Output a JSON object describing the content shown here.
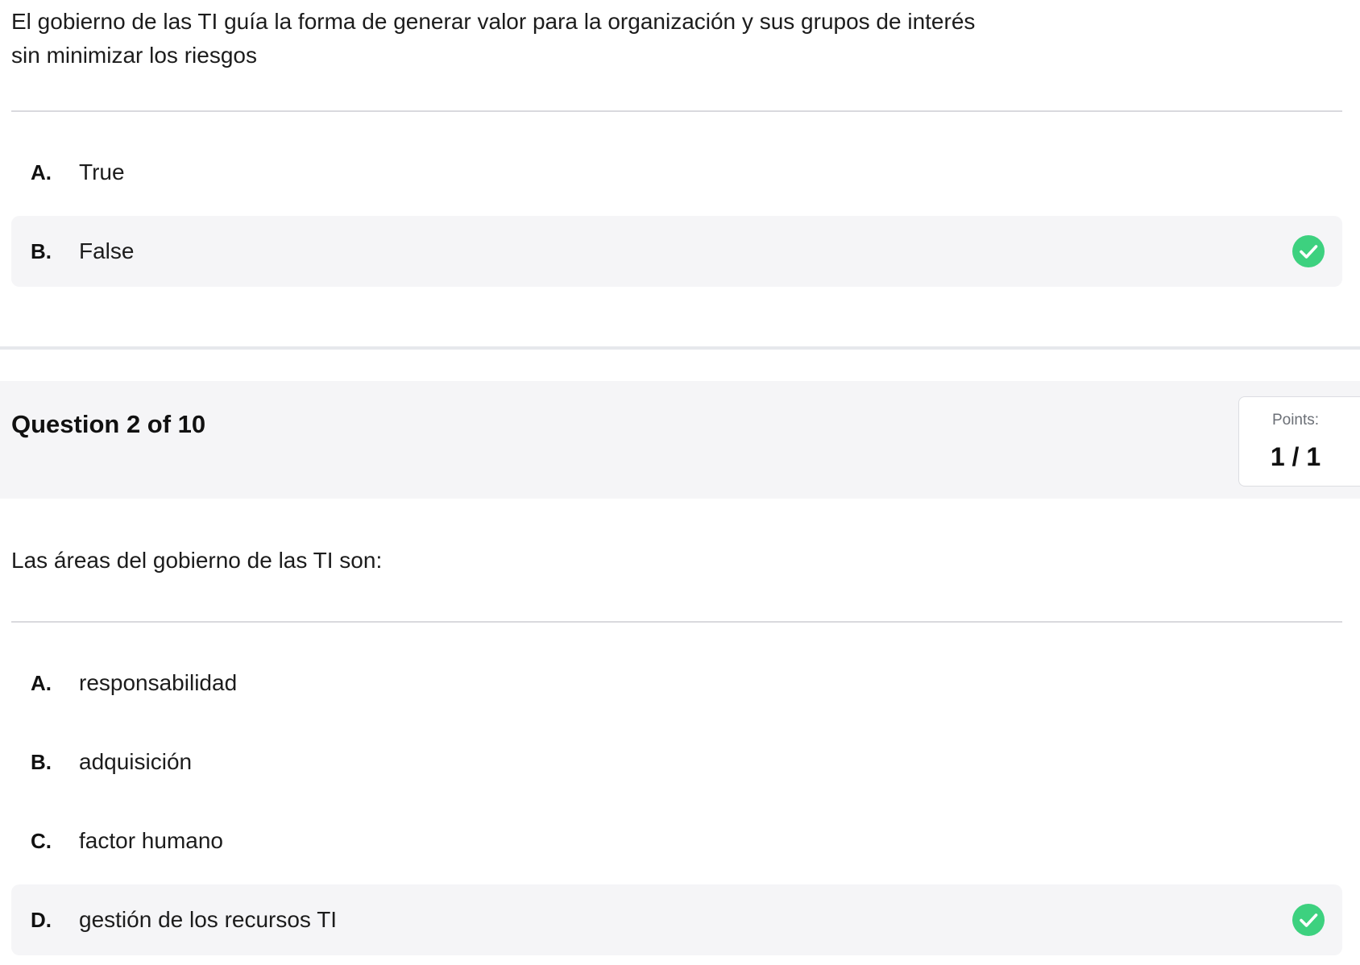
{
  "question1": {
    "text": "El gobierno de las TI guía la forma de generar valor para la organización y sus grupos de interés sin minimizar los riesgos",
    "options": [
      {
        "letter": "A.",
        "text": "True",
        "selected": false
      },
      {
        "letter": "B.",
        "text": "False",
        "selected": true,
        "icon": "check-circle-icon"
      }
    ]
  },
  "question2": {
    "title": "Question 2 of 10",
    "points_label": "Points:",
    "points_value": "1 / 1",
    "text": "Las áreas del gobierno de las TI son:",
    "options": [
      {
        "letter": "A.",
        "text": "responsabilidad",
        "selected": false
      },
      {
        "letter": "B.",
        "text": "adquisición",
        "selected": false
      },
      {
        "letter": "C.",
        "text": "factor humano",
        "selected": false
      },
      {
        "letter": "D.",
        "text": "gestión de los recursos TI",
        "selected": true,
        "icon": "check-circle-icon"
      }
    ]
  },
  "colors": {
    "check": "#3dd17f",
    "selected_bg": "#f5f5f7",
    "divider": "#d9d9de"
  }
}
